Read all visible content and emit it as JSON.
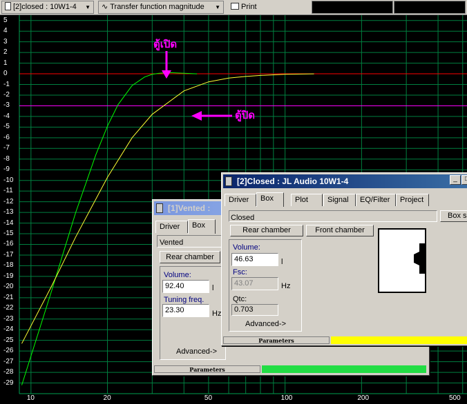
{
  "toolbar": {
    "project_select": "[2]closed : 10W1-4",
    "plot_select": "Transfer function magnitude",
    "print_label": "Print"
  },
  "chart_data": {
    "type": "line",
    "xscale": "log",
    "xlim": [
      9,
      520
    ],
    "ylim": [
      -30,
      5.5
    ],
    "ytick_labels": [
      "5",
      "4",
      "3",
      "2",
      "1",
      "0",
      "-1",
      "-2",
      "-3",
      "-4",
      "-5",
      "-6",
      "-7",
      "-8",
      "-9",
      "-10",
      "-11",
      "-12",
      "-13",
      "-14",
      "-15",
      "-16",
      "-17",
      "-18",
      "-19",
      "-20",
      "-21",
      "-22",
      "-23",
      "-24",
      "-25",
      "-26",
      "-27",
      "-28",
      "-29"
    ],
    "xtick_labels": [
      "10",
      "20",
      "50",
      "100",
      "200",
      "500"
    ],
    "xticks": [
      10,
      20,
      50,
      100,
      200,
      500
    ],
    "hlines": [
      {
        "y": 0,
        "color": "#ff0000"
      },
      {
        "y": -3,
        "color": "#ff00ff"
      }
    ],
    "series": [
      {
        "color": "#00ff00",
        "x": [
          9.2,
          12,
          15,
          18,
          20,
          22,
          25,
          28,
          30,
          32,
          34,
          36,
          40,
          45
        ],
        "y": [
          -29.2,
          -20.5,
          -13.0,
          -7.6,
          -4.9,
          -2.9,
          -1.1,
          -0.3,
          -0.05,
          0.05,
          0.1,
          0.1,
          0.05,
          0
        ]
      },
      {
        "color": "#ffff33",
        "x": [
          9.2,
          12,
          15,
          20,
          25,
          30,
          40,
          50,
          60,
          70,
          80,
          100,
          130
        ],
        "y": [
          -25.3,
          -20.0,
          -15.3,
          -9.7,
          -6.0,
          -3.8,
          -1.6,
          -0.75,
          -0.4,
          -0.25,
          -0.15,
          -0.05,
          0
        ]
      }
    ],
    "annotations": [
      "ตู้เปิด",
      "ตู้ปิด"
    ],
    "grid": true
  },
  "vented_window": {
    "title": "[1]Vented :",
    "tabs": [
      "Driver",
      "Box"
    ],
    "box_type": "Vented",
    "rear_chamber_label": "Rear chamber",
    "volume_label": "Volume:",
    "volume_value": "92.40",
    "volume_unit": "l",
    "tuning_label": "Tuning freq.",
    "tuning_value": "23.30",
    "tuning_unit": "Hz",
    "advanced_label": "Advanced->",
    "status_label": "Parameters",
    "status_color": "#22dd44"
  },
  "closed_window": {
    "title": "[2]Closed : JL Audio 10W1-4",
    "tabs": [
      "Driver",
      "Box",
      "Plot",
      "Signal",
      "EQ/Filter",
      "Project"
    ],
    "box_type": "Closed",
    "box_shape_label": "Box sh",
    "rear_chamber_label": "Rear chamber",
    "front_chamber_label": "Front chamber",
    "volume_label": "Volume:",
    "volume_value": "46.63",
    "volume_unit": "l",
    "fsc_label": "Fsc:",
    "fsc_value": "43.07",
    "fsc_unit": "Hz",
    "qtc_label": "Qtc:",
    "qtc_value": "0.703",
    "advanced_label": "Advanced->",
    "status_label": "Parameters",
    "status_color": "#ffff00",
    "minimize_label": "_",
    "maximize_label": "□"
  }
}
